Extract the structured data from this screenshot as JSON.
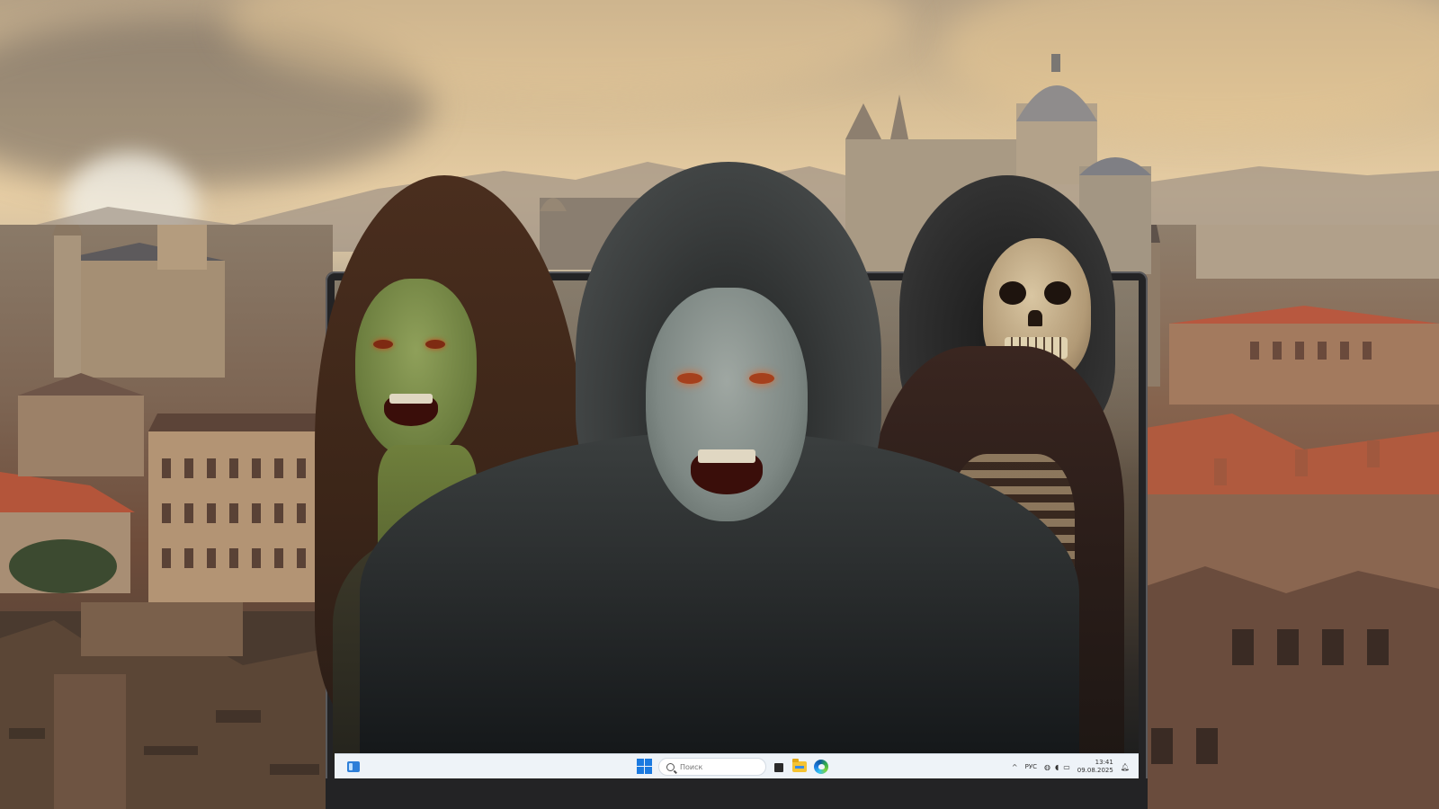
{
  "scene": {
    "description_layer": "poster",
    "screen_figures": [
      "green-skinned-woman",
      "hooded-vampire",
      "hooded-skeleton"
    ]
  },
  "taskbar": {
    "search_placeholder": "Поиск",
    "tray_chevron": "^",
    "language": "РУС",
    "time": "13:41",
    "date": "09.08.2025"
  },
  "colors": {
    "taskbar_bg": "#eef3f8",
    "start_blue": "#1b7ae0",
    "sky_warm": "#e6cda4"
  }
}
